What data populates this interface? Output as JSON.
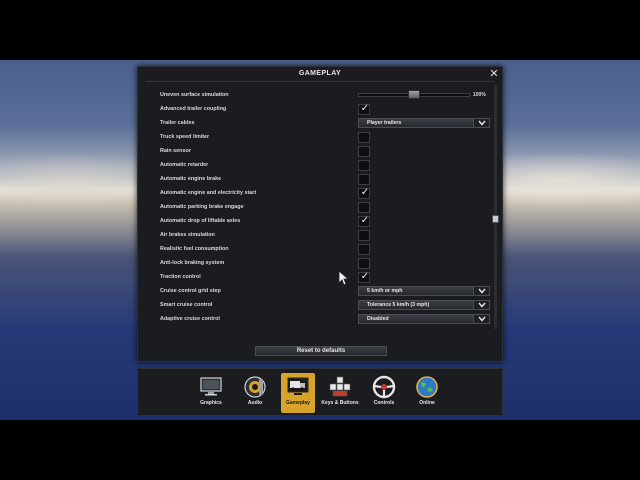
{
  "panel": {
    "title": "GAMEPLAY",
    "close_label": "✕",
    "reset_label": "Reset to defaults"
  },
  "settings": [
    {
      "label": "Uneven surface simulation",
      "type": "slider",
      "value_text": "100%",
      "level": 0.5
    },
    {
      "label": "Advanced trailer coupling",
      "type": "checkbox",
      "checked": true
    },
    {
      "label": "Trailer cables",
      "type": "dropdown",
      "value": "Player trailers"
    },
    {
      "label": "Truck speed limiter",
      "type": "checkbox",
      "checked": false
    },
    {
      "label": "Rain sensor",
      "type": "checkbox",
      "checked": false
    },
    {
      "label": "Automatic retarder",
      "type": "checkbox",
      "checked": false
    },
    {
      "label": "Automatic engine brake",
      "type": "checkbox",
      "checked": false
    },
    {
      "label": "Automatic engine and electricity start",
      "type": "checkbox",
      "checked": true
    },
    {
      "label": "Automatic parking brake engage",
      "type": "checkbox",
      "checked": false
    },
    {
      "label": "Automatic drop of liftable axles",
      "type": "checkbox",
      "checked": true
    },
    {
      "label": "Air brakes simulation",
      "type": "checkbox",
      "checked": false
    },
    {
      "label": "Realistic fuel consumption",
      "type": "checkbox",
      "checked": false
    },
    {
      "label": "Anti-lock braking system",
      "type": "checkbox",
      "checked": false
    },
    {
      "label": "Traction control",
      "type": "checkbox",
      "checked": true
    },
    {
      "label": "Cruise control grid step",
      "type": "dropdown",
      "value": "5 km/h or mph"
    },
    {
      "label": "Smart cruise control",
      "type": "dropdown",
      "value": "Tolerance 5 km/h (3 mph)"
    },
    {
      "label": "Adaptive cruise control",
      "type": "dropdown",
      "value": "Disabled"
    }
  ],
  "scroll_position": 0.55,
  "toolbar": [
    {
      "label": "Graphics",
      "icon": "monitor-icon",
      "active": false
    },
    {
      "label": "Audio",
      "icon": "speaker-icon",
      "active": false
    },
    {
      "label": "Gameplay",
      "icon": "truck-display-icon",
      "active": true
    },
    {
      "label": "Keys & Buttons",
      "icon": "keyboard-keys-icon",
      "active": false
    },
    {
      "label": "Controls",
      "icon": "steering-wheel-icon",
      "active": false
    },
    {
      "label": "Online",
      "icon": "globe-icon",
      "active": false
    }
  ],
  "colors": {
    "accent": "#d7a32a",
    "panel_bg": "#1a1c1f",
    "text": "#d9d9d9"
  }
}
